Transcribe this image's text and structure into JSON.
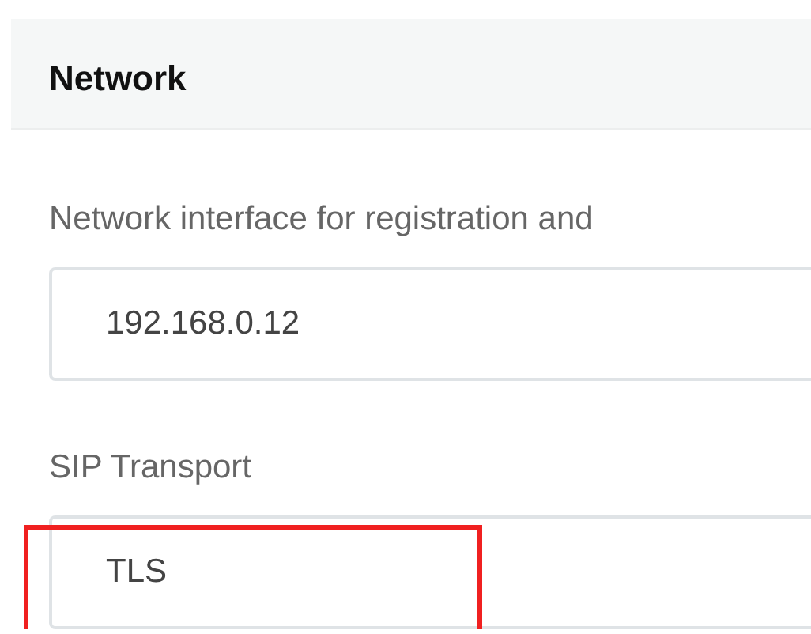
{
  "section": {
    "title": "Network"
  },
  "fields": [
    {
      "label": "Network interface for registration and",
      "value": "192.168.0.12",
      "highlighted": false
    },
    {
      "label": "SIP Transport",
      "value": "TLS",
      "highlighted": true
    }
  ]
}
